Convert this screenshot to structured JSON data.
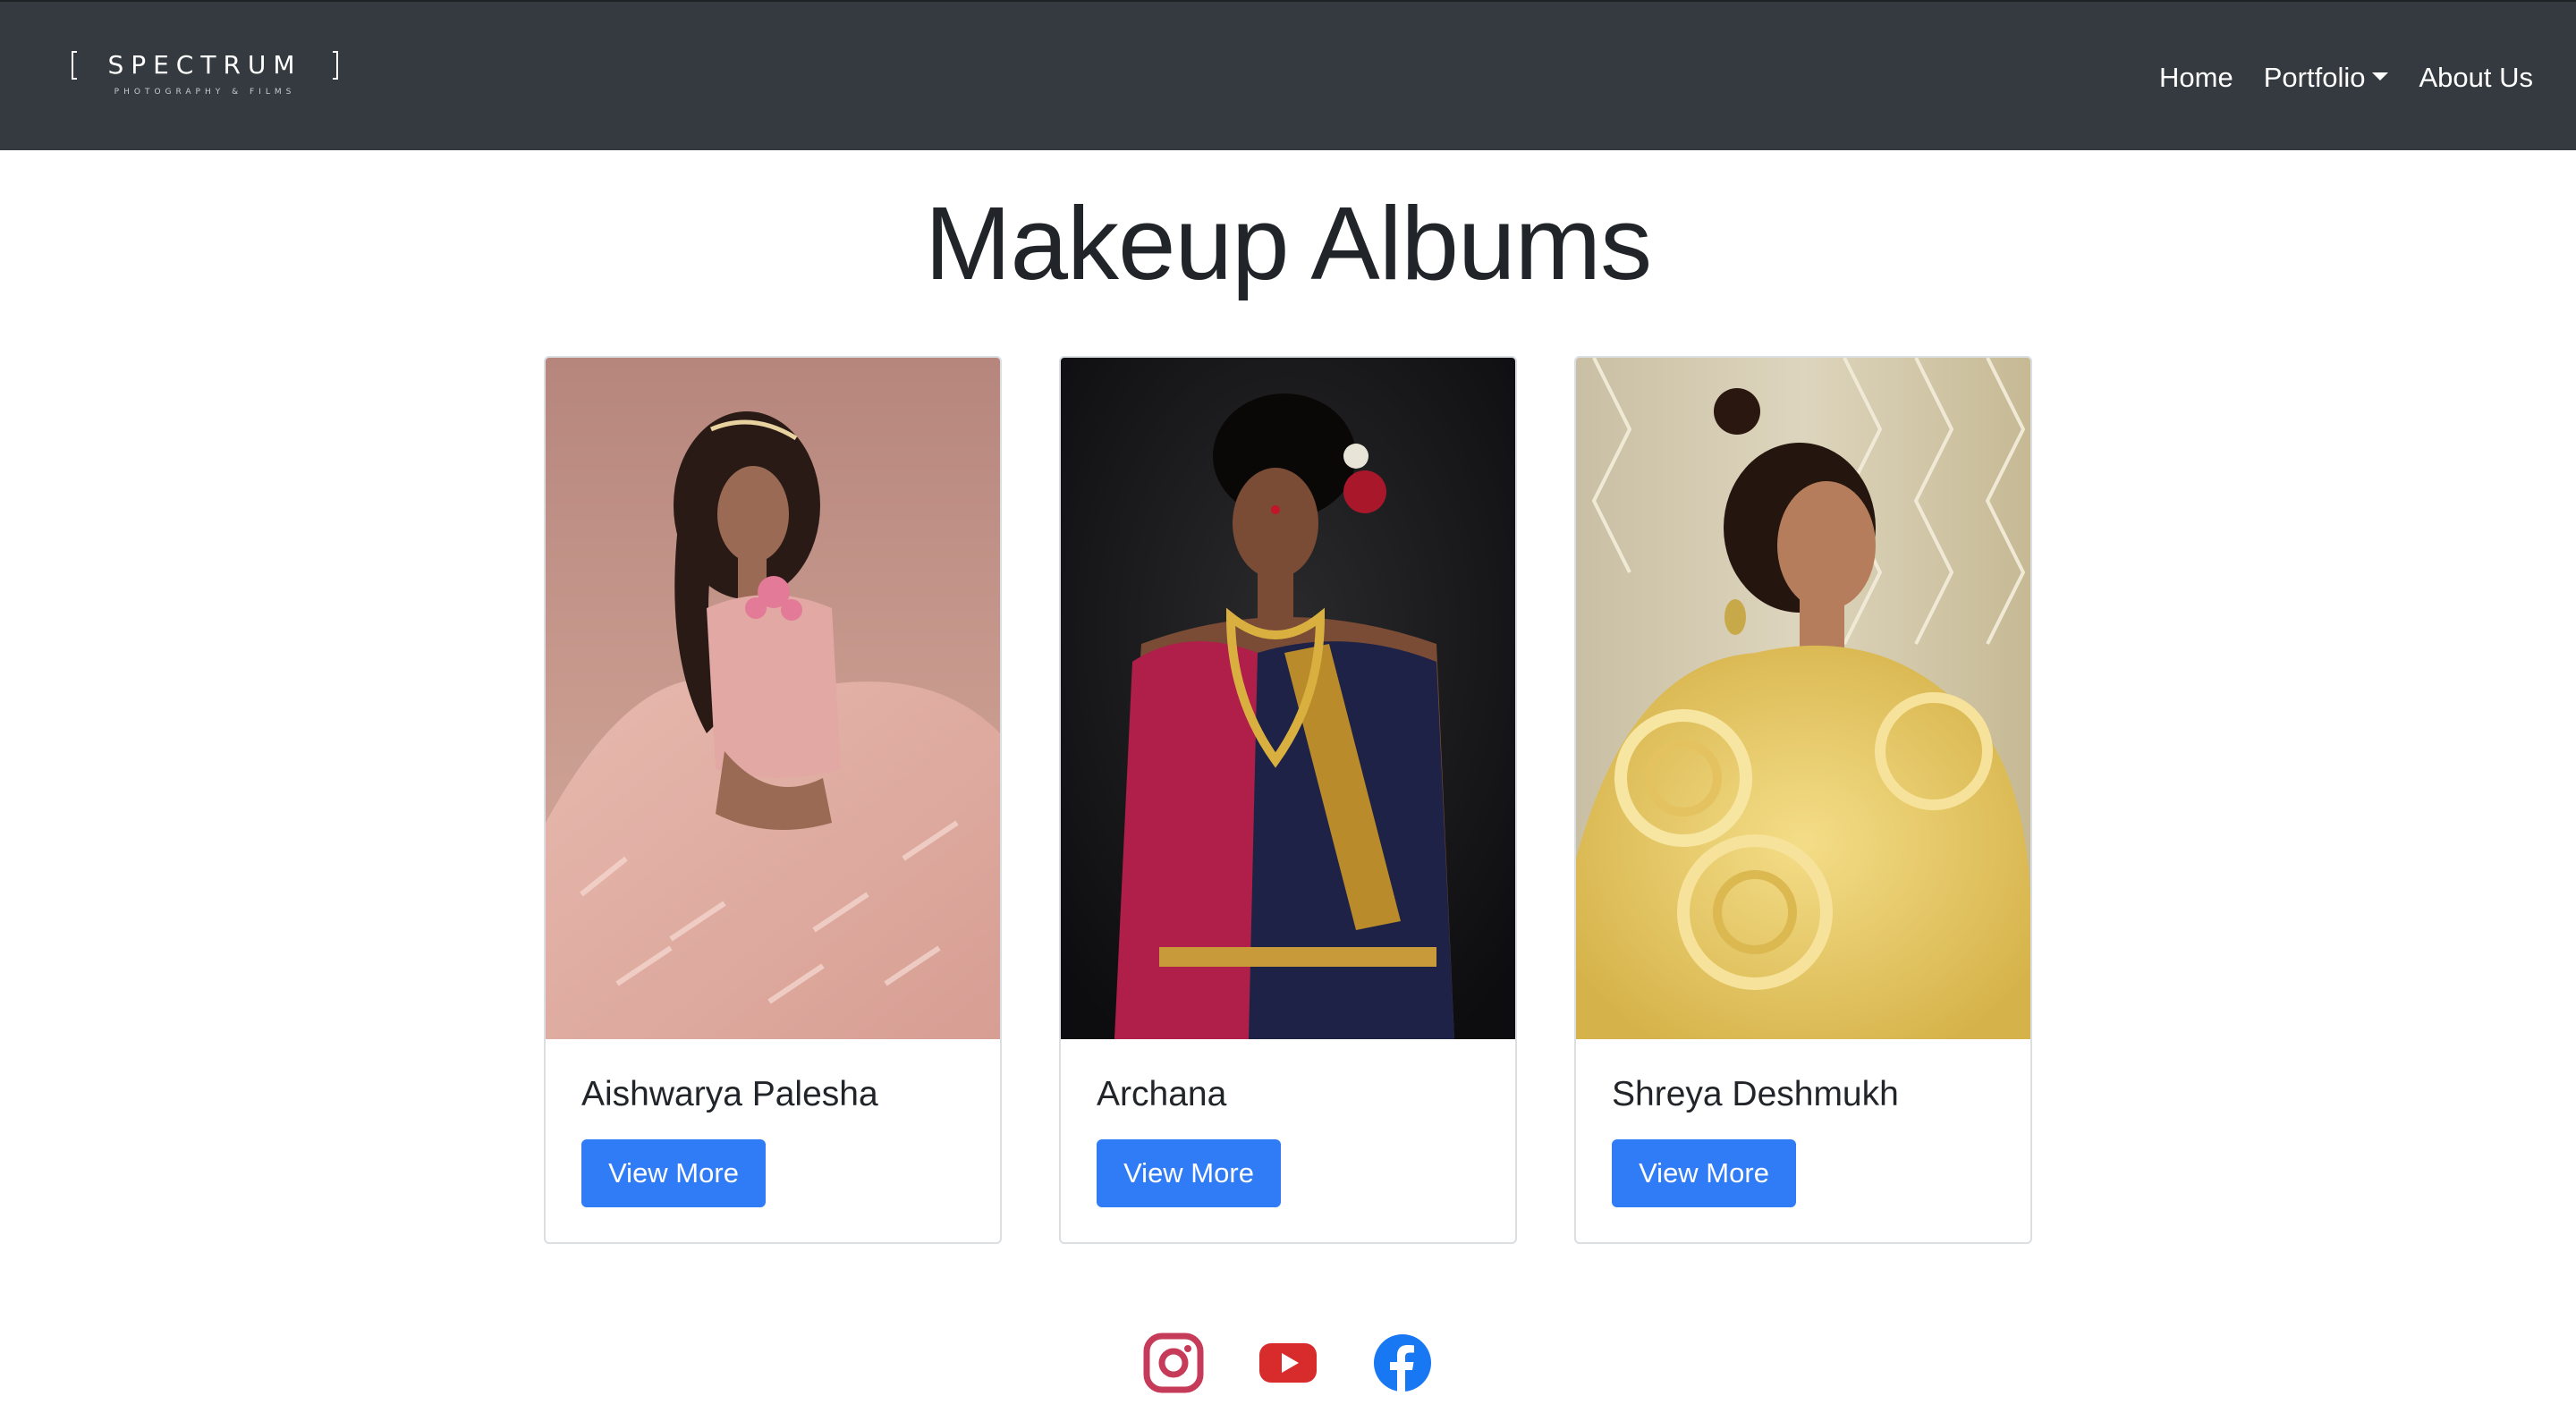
{
  "navbar": {
    "brand": {
      "name": "SPECTRUM",
      "tagline": "PHOTOGRAPHY & FILMS"
    },
    "links": [
      {
        "label": "Home"
      },
      {
        "label": "Portfolio",
        "has_dropdown": true
      },
      {
        "label": "About Us"
      }
    ]
  },
  "main": {
    "title": "Makeup Albums",
    "albums": [
      {
        "name": "Aishwarya Palesha",
        "button_label": "View More",
        "image": "bride-in-pink-lehenga"
      },
      {
        "name": "Archana",
        "button_label": "View More",
        "image": "woman-in-traditional-saree-gold-jewellery"
      },
      {
        "name": "Shreya Deshmukh",
        "button_label": "View More",
        "image": "woman-in-yellow-ruffled-gown"
      }
    ]
  },
  "footer": {
    "social": [
      {
        "icon": "instagram-icon",
        "color": "#c13584"
      },
      {
        "icon": "youtube-icon",
        "color": "#e62117"
      },
      {
        "icon": "facebook-icon",
        "color": "#1877f2"
      }
    ]
  },
  "colors": {
    "navbar": "#343a40",
    "button": "#2f7cf6",
    "text": "#212529"
  }
}
